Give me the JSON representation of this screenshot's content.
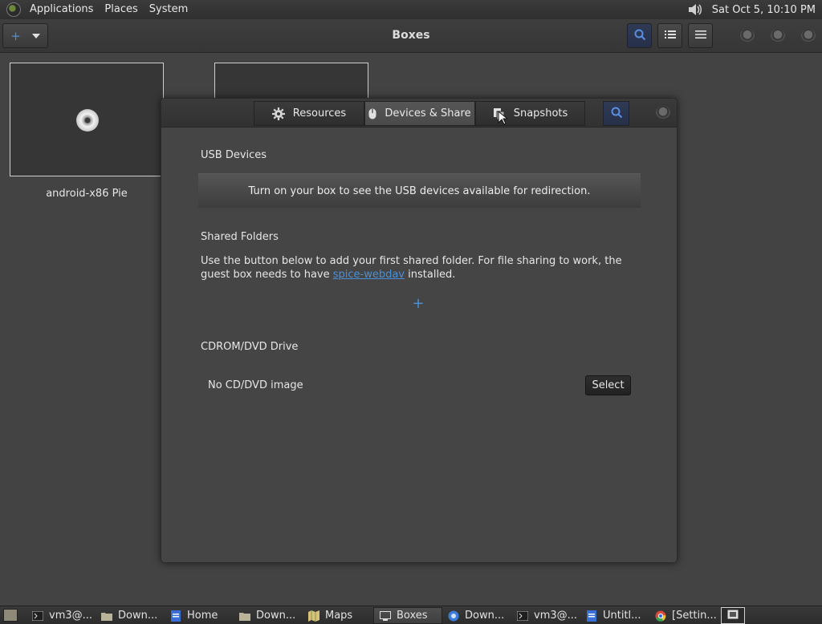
{
  "top_panel": {
    "menus": [
      "Applications",
      "Places",
      "System"
    ],
    "clock": "Sat Oct  5, 10:10 PM"
  },
  "header": {
    "title": "Boxes"
  },
  "collection": {
    "boxes": [
      {
        "name": "android-x86 Pie"
      },
      {
        "name": ""
      }
    ]
  },
  "properties": {
    "tabs": [
      {
        "label": "Resources",
        "icon": "gear-icon"
      },
      {
        "label": "Devices & Share",
        "icon": "mouse-icon"
      },
      {
        "label": "Snapshots",
        "icon": "snapshot-icon"
      }
    ],
    "usb": {
      "title": "USB Devices",
      "message": "Turn on your box to see the USB devices available for redirection."
    },
    "shared": {
      "title": "Shared Folders",
      "desc_before": "Use the button below to add your first shared folder. For file sharing to work, the guest box needs to have ",
      "link": "spice-webdav",
      "desc_after": " installed."
    },
    "cdrom": {
      "title": "CDROM/DVD Drive",
      "value": "No CD/DVD image",
      "select_label": "Select"
    }
  },
  "taskbar": {
    "items": [
      {
        "label": "vm3@...",
        "icon": "terminal-icon"
      },
      {
        "label": "Down...",
        "icon": "folder-icon"
      },
      {
        "label": "Home",
        "icon": "document-icon"
      },
      {
        "label": "Down...",
        "icon": "folder-icon"
      },
      {
        "label": "Maps",
        "icon": "map-icon"
      },
      {
        "label": "Boxes",
        "icon": "boxes-icon"
      },
      {
        "label": "Down...",
        "icon": "browser-icon"
      },
      {
        "label": "vm3@...",
        "icon": "terminal-icon"
      },
      {
        "label": "Untitl...",
        "icon": "document-icon"
      },
      {
        "label": "[Settin...",
        "icon": "chrome-icon"
      }
    ]
  },
  "colors": {
    "accent": "#4a90d9",
    "background": "#434343"
  }
}
